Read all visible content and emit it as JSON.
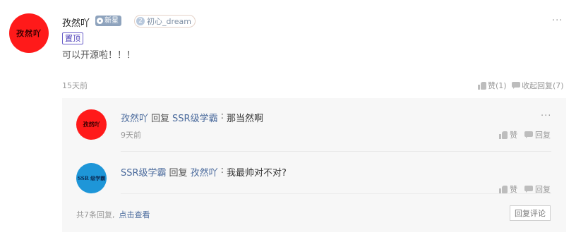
{
  "comment": {
    "avatar_text": "孜然吖",
    "author": "孜然吖",
    "badge_new": "新星",
    "fan_badge_level": "2",
    "fan_badge_name": "初心_dream",
    "more": "···",
    "pin_tag": "置顶",
    "text": "可以开源啦！！！",
    "time": "15天前",
    "like_label": "赞(1)",
    "collapse_label": "收起回复(7)"
  },
  "replies": [
    {
      "avatar_text": "孜然吖",
      "author": "孜然吖",
      "reply_word": "回复",
      "target": "SSR级学霸",
      "colon": ":",
      "text": "那当然啊",
      "time": "9天前",
      "more": "···",
      "like_label": "赞",
      "reply_label": "回复"
    },
    {
      "avatar_text": "SSR 级学霸",
      "author": "SSR级学霸",
      "reply_word": "回复",
      "target": "孜然吖",
      "colon": ":",
      "text": "我最帅对不对?",
      "like_label": "赞",
      "reply_label": "回复"
    }
  ],
  "footer": {
    "count_text": "共7条回复,",
    "view_link": "点击查看",
    "reply_button": "回复评论"
  },
  "colors": {
    "avatar_red": "#ff1a1a",
    "avatar_blue": "#1e96d8",
    "link": "#4a6a9c",
    "pin": "#4b3db8"
  }
}
